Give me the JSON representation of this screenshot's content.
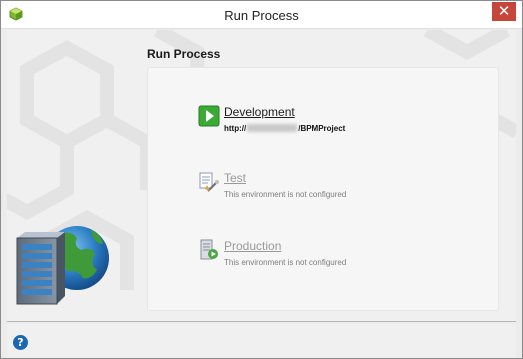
{
  "window": {
    "title": "Run Process",
    "close_glyph": "✕"
  },
  "page": {
    "heading": "Run Process"
  },
  "environments": [
    {
      "name": "Development",
      "url_prefix": "http://",
      "url_suffix": "/BPMProject",
      "icon": "play-icon",
      "status": "active"
    },
    {
      "name": "Test",
      "subtitle": "This environment is not configured",
      "icon": "test-tools-icon",
      "status": "disabled"
    },
    {
      "name": "Production",
      "subtitle": "This environment is not configured",
      "icon": "production-server-icon",
      "status": "disabled"
    }
  ],
  "footer": {
    "help_glyph": "?"
  },
  "colors": {
    "accent_green": "#3aa935",
    "close_red": "#c7463b",
    "help_blue": "#1b67b2"
  }
}
